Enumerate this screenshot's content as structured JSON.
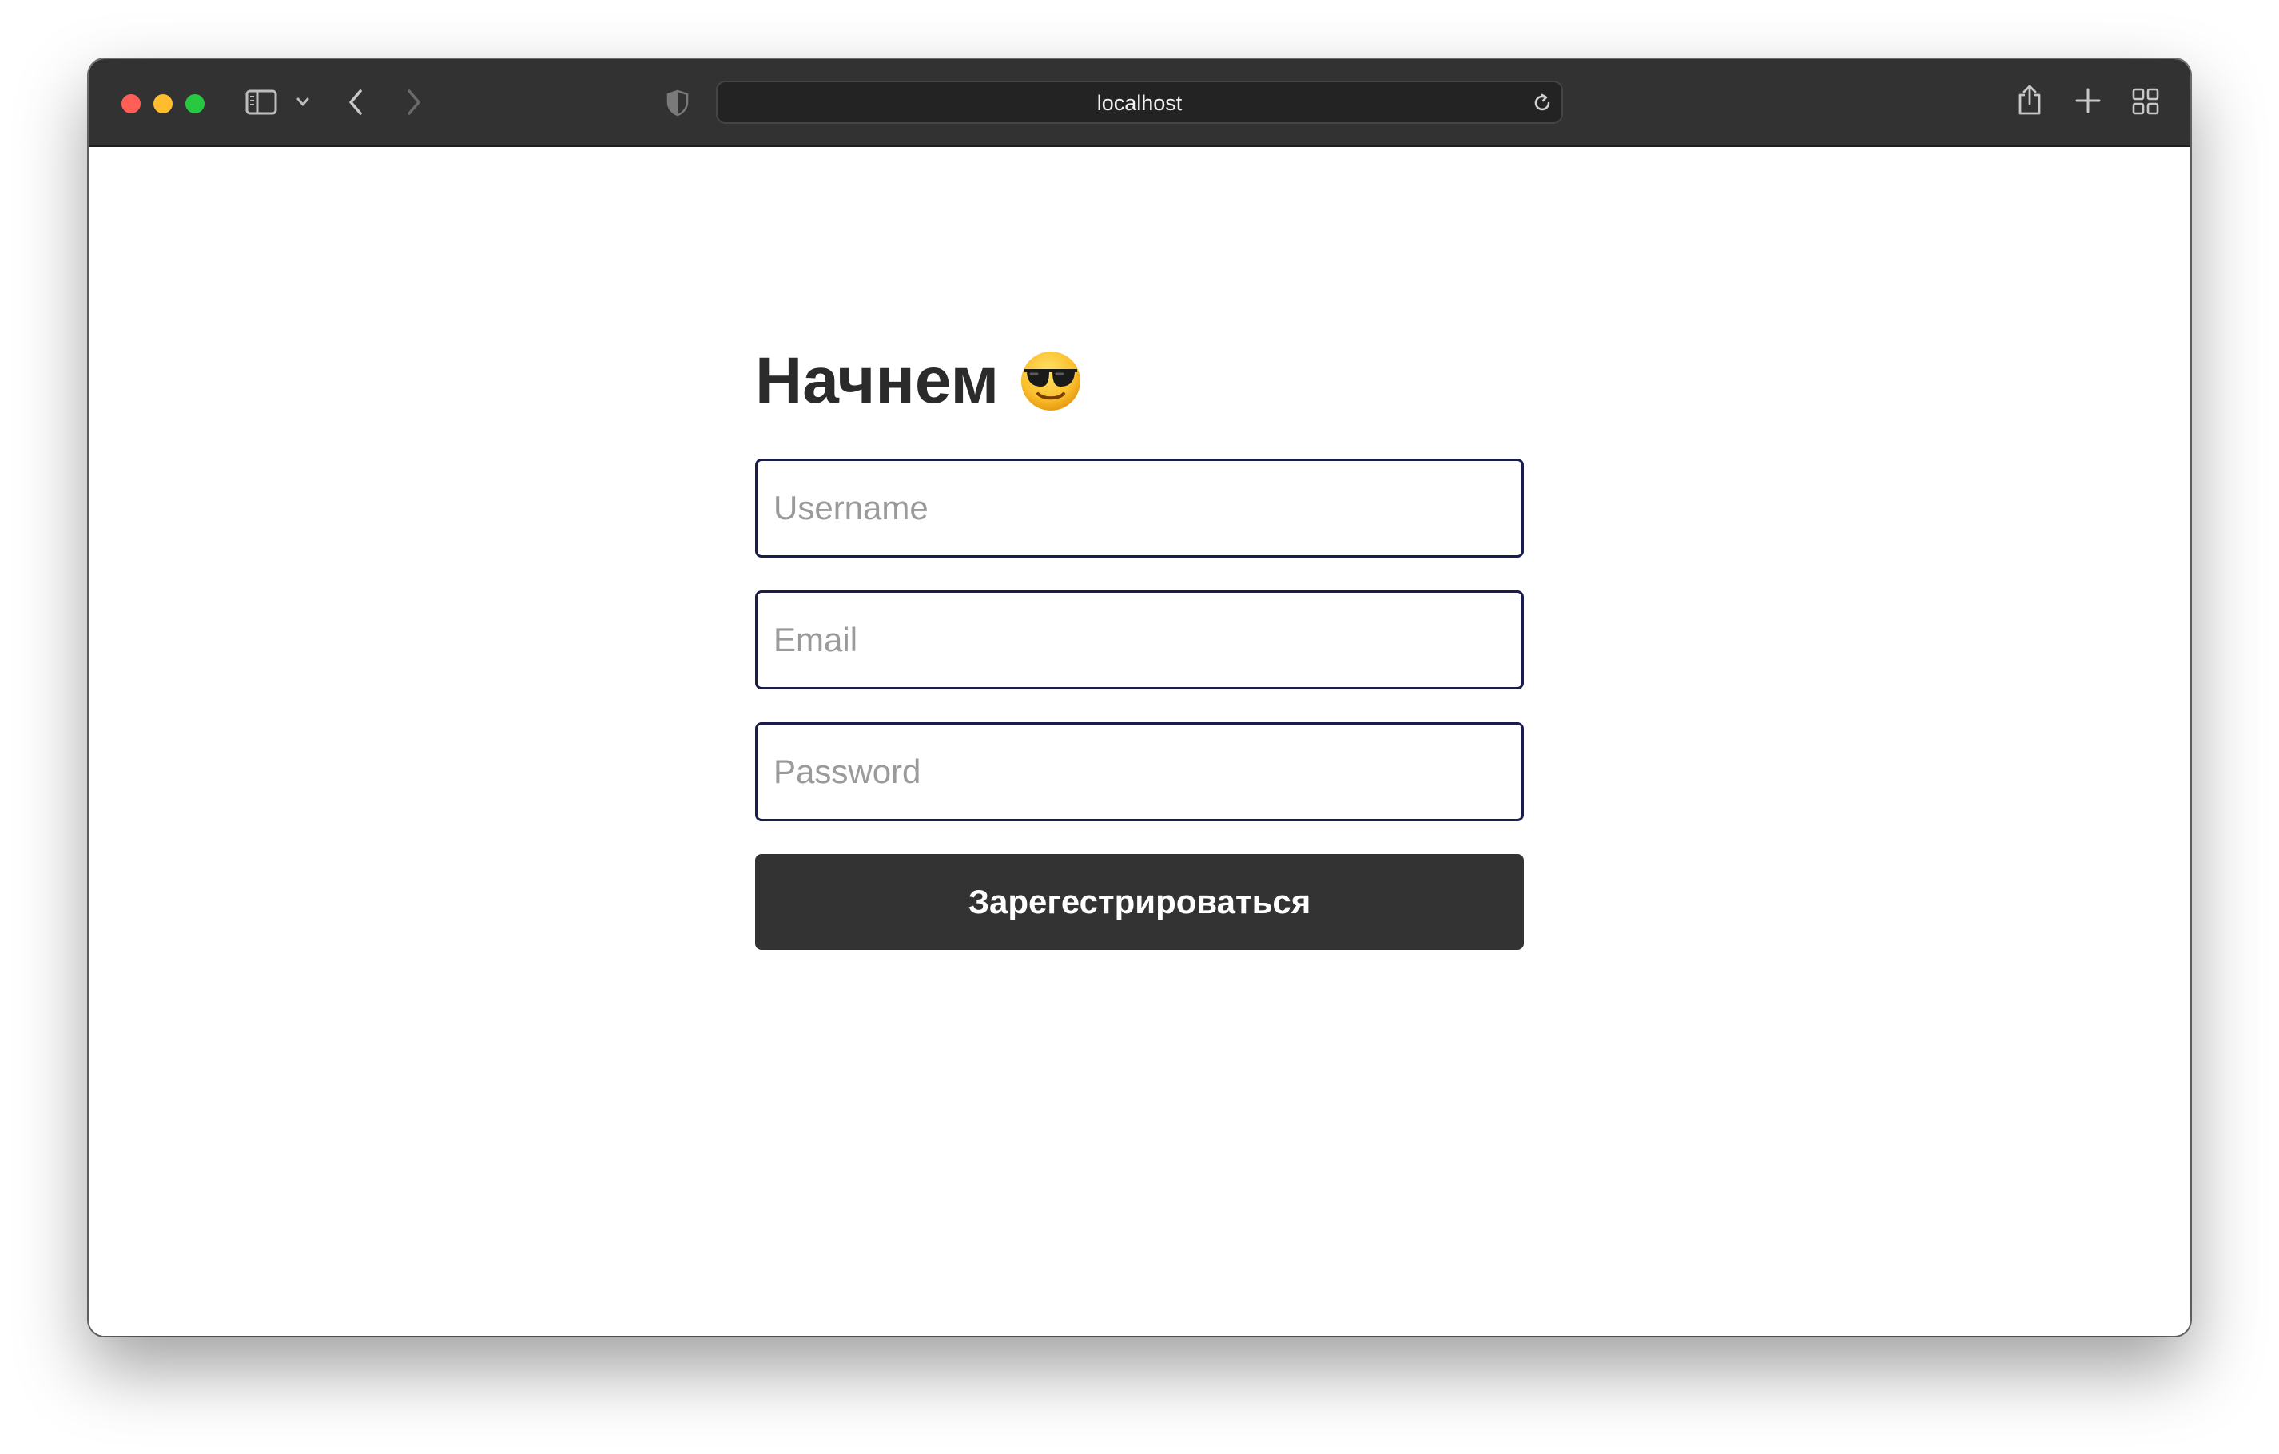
{
  "browser": {
    "address_bar": {
      "url": "localhost"
    },
    "traffic_lights": {
      "close_color": "#ff5f57",
      "minimize_color": "#febc2e",
      "maximize_color": "#28c840"
    },
    "icons": {
      "sidebar": "sidebar-toggle-icon",
      "sidebar_menu": "chevron-down-icon",
      "back": "back-arrow-icon",
      "forward": "forward-arrow-icon",
      "privacy": "shield-icon",
      "reload": "reload-icon",
      "share": "share-icon",
      "new_tab": "plus-icon",
      "tab_overview": "tab-grid-icon"
    },
    "toolbar_color": "#323232"
  },
  "signup_form": {
    "heading": "Начнем",
    "heading_emoji": "smiling-face-with-sunglasses",
    "username": {
      "value": "",
      "placeholder": "Username"
    },
    "email": {
      "value": "",
      "placeholder": "Email"
    },
    "password": {
      "value": "",
      "placeholder": "Password"
    },
    "submit_label": "Зарегестрироваться",
    "colors": {
      "field_border": "#1a1d4a",
      "button_background": "#333333",
      "button_text": "#ffffff",
      "heading_text": "#2b2b2b"
    }
  }
}
